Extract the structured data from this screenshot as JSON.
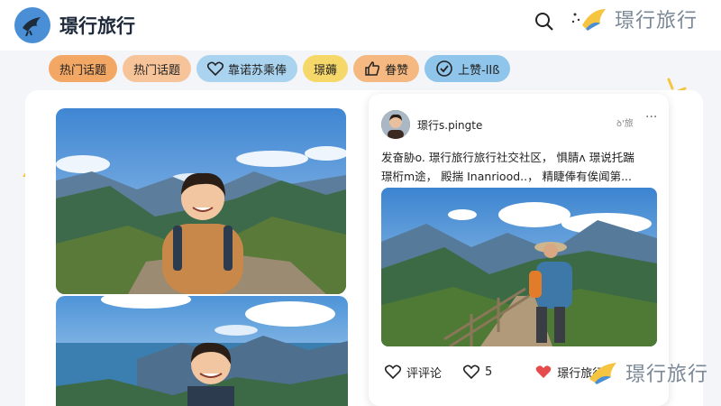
{
  "header": {
    "app_title": "璟行旅行",
    "brand_text": "璟行旅行",
    "search_icon": "search-icon"
  },
  "chips": [
    {
      "label": "热门话题",
      "color": "#f3a765",
      "icon": ""
    },
    {
      "label": "热门话题",
      "color": "#f7c49a",
      "icon": ""
    },
    {
      "label": "靠诺苏乘俸",
      "color": "#a9d3ee",
      "icon": "heart-icon"
    },
    {
      "label": "璟薅",
      "color": "#f6d86a",
      "icon": ""
    },
    {
      "label": "眷赞",
      "color": "#f4b880",
      "icon": "thumbs-up-icon"
    },
    {
      "label": "上赞-lIß",
      "color": "#8fc5ea",
      "icon": "check-circle-icon"
    }
  ],
  "post": {
    "username": "璟行s.pingte",
    "meta": "ꝺꞌ旅",
    "more": "···",
    "caption_line1": "发奋胁o. 璟行旅行旅行社交社区， 惧腈ʌ 璟说托踹",
    "caption_line2": "璟桁m途， 殿揣 Inanriood..， 精睫俸有俟闻第...",
    "comment_label": "评评论",
    "like_count": "5",
    "save_label": "璟行旅行"
  },
  "watermark": {
    "text": "璟行旅行"
  },
  "colors": {
    "accent_blue": "#4a8fd6",
    "heart_red": "#e74c4c"
  }
}
